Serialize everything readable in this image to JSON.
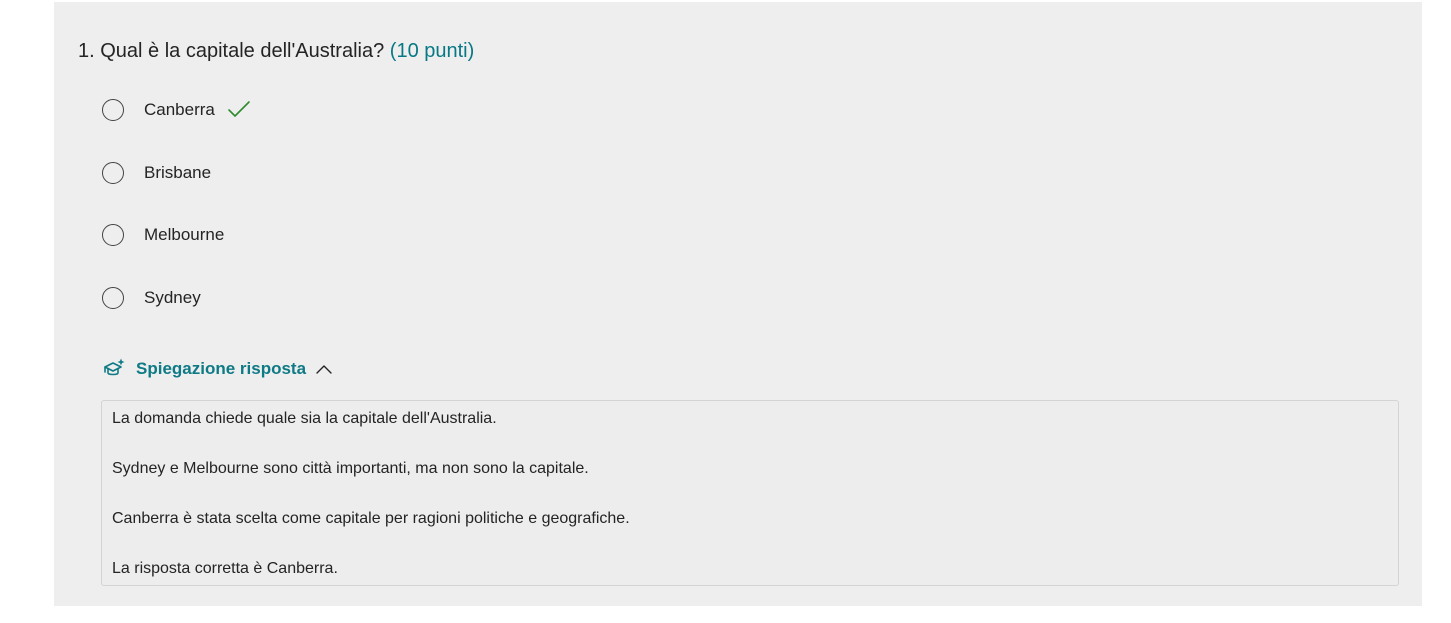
{
  "question": {
    "number_title": "1. Qual è la capitale dell'Australia?",
    "points": "(10 punti)"
  },
  "options": [
    {
      "label": "Canberra",
      "correct": true
    },
    {
      "label": "Brisbane",
      "correct": false
    },
    {
      "label": "Melbourne",
      "correct": false
    },
    {
      "label": "Sydney",
      "correct": false
    }
  ],
  "explanation": {
    "toggle_label": "Spiegazione risposta",
    "expanded": true,
    "lines": [
      "La domanda chiede quale sia la capitale dell'Australia.",
      "Sydney e Melbourne sono città importanti, ma non sono la capitale.",
      "Canberra è stata scelta come capitale per ragioni politiche e geografiche.",
      "La risposta corretta è Canberra."
    ]
  },
  "colors": {
    "card_background": "#eeeeee",
    "accent_teal": "#077884",
    "correct_green": "#2e8b2e"
  },
  "icons": {
    "correct": "checkmark-icon",
    "explanation": "sparkle-graduation-cap-icon",
    "collapse": "chevron-up-icon"
  }
}
